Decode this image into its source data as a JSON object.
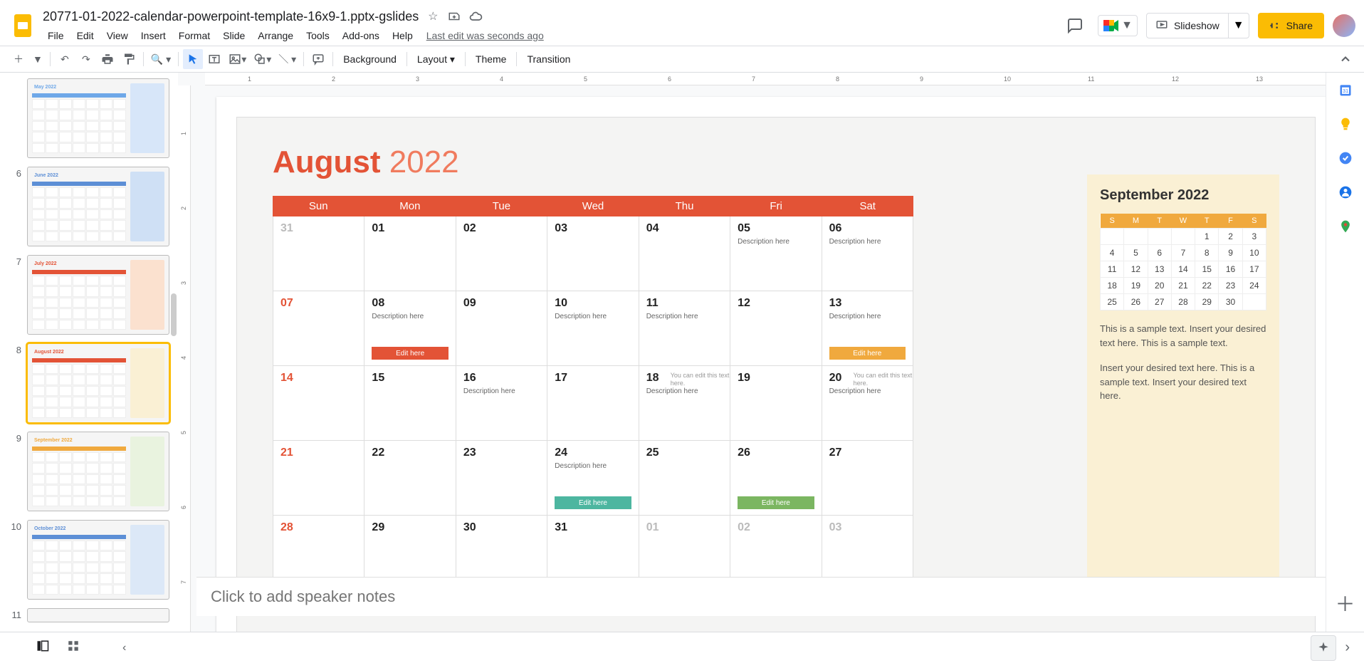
{
  "doc_title": "20771-01-2022-calendar-powerpoint-template-16x9-1.pptx-gslides",
  "menus": [
    "File",
    "Edit",
    "View",
    "Insert",
    "Format",
    "Slide",
    "Arrange",
    "Tools",
    "Add-ons",
    "Help"
  ],
  "last_edit": "Last edit was seconds ago",
  "slideshow_label": "Slideshow",
  "share_label": "Share",
  "toolbar_text": {
    "background": "Background",
    "layout": "Layout",
    "theme": "Theme",
    "transition": "Transition"
  },
  "ruler_h": [
    "1",
    "2",
    "3",
    "4",
    "5",
    "6",
    "7",
    "8",
    "9",
    "10",
    "11",
    "12",
    "13"
  ],
  "ruler_v": [
    "1",
    "2",
    "3",
    "4",
    "5",
    "6",
    "7"
  ],
  "filmstrip": [
    {
      "n": "",
      "title": "May 2022",
      "color": "#6fa8e8",
      "mini": "#d7e6f9"
    },
    {
      "n": "6",
      "title": "June 2022",
      "color": "#5d8fd6",
      "mini": "#cfe0f5"
    },
    {
      "n": "7",
      "title": "July 2022",
      "color": "#e35336",
      "mini": "#fbe1cf"
    },
    {
      "n": "8",
      "title": "August 2022",
      "color": "#e35336",
      "mini": "#faf0d4",
      "selected": true
    },
    {
      "n": "9",
      "title": "September 2022",
      "color": "#f0a93e",
      "mini": "#e9f3df"
    },
    {
      "n": "10",
      "title": "October 2022",
      "color": "#5d8fd6",
      "mini": "#dce8f7"
    },
    {
      "n": "11",
      "title": "",
      "color": "#888",
      "mini": "#eee",
      "tiny": true
    }
  ],
  "slide": {
    "month": "August",
    "year": "2022",
    "days": [
      "Sun",
      "Mon",
      "Tue",
      "Wed",
      "Thu",
      "Fri",
      "Sat"
    ],
    "cells": [
      {
        "d": "31",
        "out": true
      },
      {
        "d": "01"
      },
      {
        "d": "02"
      },
      {
        "d": "03"
      },
      {
        "d": "04"
      },
      {
        "d": "05",
        "desc": "Description here"
      },
      {
        "d": "06",
        "desc": "Description here"
      },
      {
        "d": "07",
        "sun": true
      },
      {
        "d": "08",
        "desc": "Description here",
        "tag": "Edit here",
        "tagc": "tag-orange"
      },
      {
        "d": "09"
      },
      {
        "d": "10",
        "desc": "Description here"
      },
      {
        "d": "11",
        "desc": "Description here"
      },
      {
        "d": "12"
      },
      {
        "d": "13",
        "desc": "Description here",
        "tag": "Edit here",
        "tagc": "tag-yellow"
      },
      {
        "d": "14",
        "sun": true
      },
      {
        "d": "15"
      },
      {
        "d": "16",
        "desc": "Description here"
      },
      {
        "d": "17"
      },
      {
        "d": "18",
        "desc": "Description here",
        "note": "You can edit this text here."
      },
      {
        "d": "19"
      },
      {
        "d": "20",
        "desc": "Description here",
        "note": "You can edit this text here."
      },
      {
        "d": "21",
        "sun": true
      },
      {
        "d": "22"
      },
      {
        "d": "23"
      },
      {
        "d": "24",
        "desc": "Description here",
        "tag": "Edit here",
        "tagc": "tag-teal"
      },
      {
        "d": "25"
      },
      {
        "d": "26",
        "tag": "Edit here",
        "tagc": "tag-green"
      },
      {
        "d": "27"
      },
      {
        "d": "28",
        "sun": true
      },
      {
        "d": "29"
      },
      {
        "d": "30"
      },
      {
        "d": "31"
      },
      {
        "d": "01",
        "out": true
      },
      {
        "d": "02",
        "out": true
      },
      {
        "d": "03",
        "out": true
      }
    ],
    "mini_title": "September 2022",
    "mini_head": [
      "S",
      "M",
      "T",
      "W",
      "T",
      "F",
      "S"
    ],
    "mini_rows": [
      [
        "",
        "",
        "",
        "",
        "1",
        "2",
        "3"
      ],
      [
        "4",
        "5",
        "6",
        "7",
        "8",
        "9",
        "10"
      ],
      [
        "11",
        "12",
        "13",
        "14",
        "15",
        "16",
        "17"
      ],
      [
        "18",
        "19",
        "20",
        "21",
        "22",
        "23",
        "24"
      ],
      [
        "25",
        "26",
        "27",
        "28",
        "29",
        "30",
        ""
      ]
    ],
    "mini_text1": "This is a sample text. Insert your desired text here. This is a sample text.",
    "mini_text2": "Insert your desired text here. This is a sample text. Insert your desired text here."
  },
  "notes_placeholder": "Click to add speaker notes"
}
